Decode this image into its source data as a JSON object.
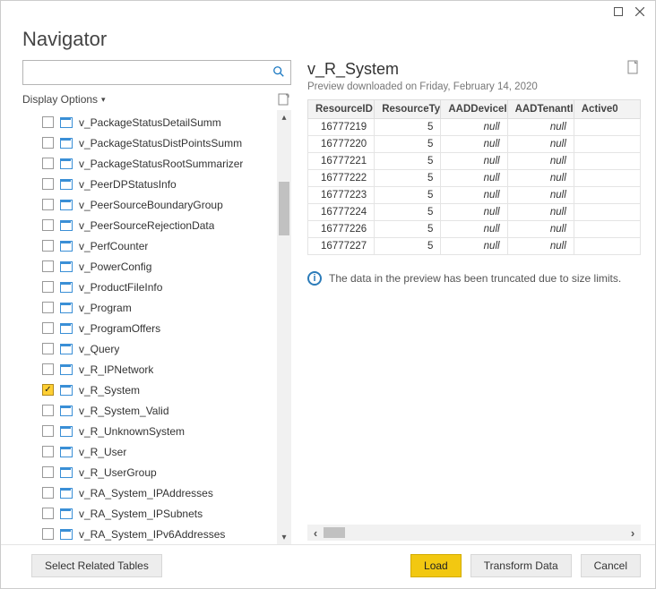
{
  "window": {
    "title": "Navigator"
  },
  "left_panel": {
    "search_placeholder": "",
    "display_options_label": "Display Options",
    "items": [
      {
        "label": "v_PackageStatusDetailSumm",
        "checked": false
      },
      {
        "label": "v_PackageStatusDistPointsSumm",
        "checked": false
      },
      {
        "label": "v_PackageStatusRootSummarizer",
        "checked": false
      },
      {
        "label": "v_PeerDPStatusInfo",
        "checked": false
      },
      {
        "label": "v_PeerSourceBoundaryGroup",
        "checked": false
      },
      {
        "label": "v_PeerSourceRejectionData",
        "checked": false
      },
      {
        "label": "v_PerfCounter",
        "checked": false
      },
      {
        "label": "v_PowerConfig",
        "checked": false
      },
      {
        "label": "v_ProductFileInfo",
        "checked": false
      },
      {
        "label": "v_Program",
        "checked": false
      },
      {
        "label": "v_ProgramOffers",
        "checked": false
      },
      {
        "label": "v_Query",
        "checked": false
      },
      {
        "label": "v_R_IPNetwork",
        "checked": false
      },
      {
        "label": "v_R_System",
        "checked": true
      },
      {
        "label": "v_R_System_Valid",
        "checked": false
      },
      {
        "label": "v_R_UnknownSystem",
        "checked": false
      },
      {
        "label": "v_R_User",
        "checked": false
      },
      {
        "label": "v_R_UserGroup",
        "checked": false
      },
      {
        "label": "v_RA_System_IPAddresses",
        "checked": false
      },
      {
        "label": "v_RA_System_IPSubnets",
        "checked": false
      },
      {
        "label": "v_RA_System_IPv6Addresses",
        "checked": false
      }
    ]
  },
  "preview": {
    "title": "v_R_System",
    "subtitle": "Preview downloaded on Friday, February 14, 2020",
    "columns": [
      "ResourceID",
      "ResourceType",
      "AADDeviceID",
      "AADTenantID",
      "Active0"
    ],
    "rows": [
      [
        "16777219",
        "5",
        "null",
        "null",
        ""
      ],
      [
        "16777220",
        "5",
        "null",
        "null",
        ""
      ],
      [
        "16777221",
        "5",
        "null",
        "null",
        ""
      ],
      [
        "16777222",
        "5",
        "null",
        "null",
        ""
      ],
      [
        "16777223",
        "5",
        "null",
        "null",
        ""
      ],
      [
        "16777224",
        "5",
        "null",
        "null",
        ""
      ],
      [
        "16777226",
        "5",
        "null",
        "null",
        ""
      ],
      [
        "16777227",
        "5",
        "null",
        "null",
        ""
      ]
    ],
    "info_message": "The data in the preview has been truncated due to size limits."
  },
  "footer": {
    "select_related": "Select Related Tables",
    "load": "Load",
    "transform": "Transform Data",
    "cancel": "Cancel"
  }
}
